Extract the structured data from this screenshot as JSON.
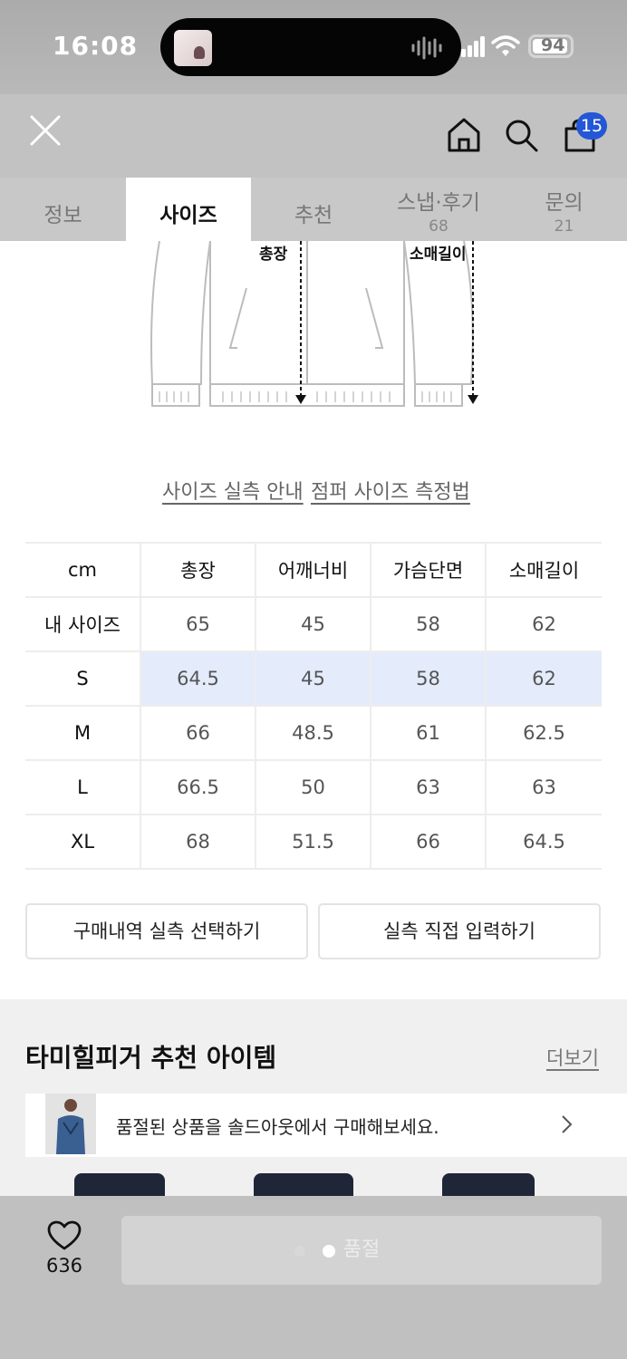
{
  "status_bar": {
    "time": "16:08",
    "battery": "94"
  },
  "header": {
    "cart_count": "15"
  },
  "tabs": [
    {
      "label": "정보",
      "count": ""
    },
    {
      "label": "사이즈",
      "count": ""
    },
    {
      "label": "추천",
      "count": ""
    },
    {
      "label": "스냅·후기",
      "count": "68"
    },
    {
      "label": "문의",
      "count": "21"
    }
  ],
  "drawing": {
    "total_length_label": "총장",
    "sleeve_length_label": "소매길이"
  },
  "size_links": {
    "guide": "사이즈 실측 안내",
    "method": "점퍼 사이즈 측정법"
  },
  "size_table": {
    "unit": "cm",
    "columns": [
      "총장",
      "어깨너비",
      "가슴단면",
      "소매길이"
    ],
    "rows": [
      {
        "size": "내 사이즈",
        "values": [
          "65",
          "45",
          "58",
          "62"
        ]
      },
      {
        "size": "S",
        "values": [
          "64.5",
          "45",
          "58",
          "62"
        ],
        "highlighted": true
      },
      {
        "size": "M",
        "values": [
          "66",
          "48.5",
          "61",
          "62.5"
        ]
      },
      {
        "size": "L",
        "values": [
          "66.5",
          "50",
          "63",
          "63"
        ]
      },
      {
        "size": "XL",
        "values": [
          "68",
          "51.5",
          "66",
          "64.5"
        ]
      }
    ],
    "highlight_color": "#e4ecfb"
  },
  "actions": {
    "purchase_history": "구매내역 실측 선택하기",
    "direct_input": "실측 직접 입력하기"
  },
  "recommend": {
    "title": "타미힐피거 추천 아이템",
    "more": "더보기",
    "soldout_banner": "품절된 상품을 솔드아웃에서 구매해보세요."
  },
  "bottom_bar": {
    "like_count": "636",
    "buy_label": "품절"
  },
  "colors": {
    "accent": "#2457d6"
  }
}
